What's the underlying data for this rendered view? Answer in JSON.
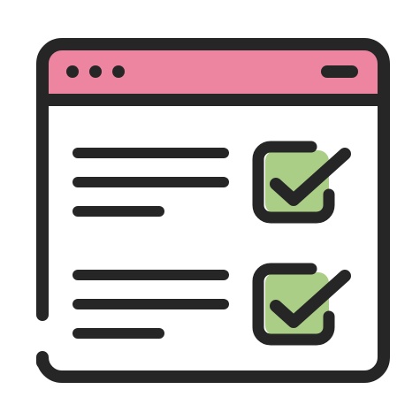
{
  "icon": {
    "name": "browser-checklist-icon",
    "colors": {
      "outline": "#262626",
      "title_bar": "#ED84A0",
      "window_body": "#FFFFFF",
      "checkbox_fill": "#ABCE87"
    },
    "window": {
      "title_bar_dots": 3,
      "title_bar_controls": [
        "minimize-icon"
      ]
    },
    "checklist": {
      "items": [
        {
          "checked": true,
          "text_lines": 3
        },
        {
          "checked": true,
          "text_lines": 3
        }
      ]
    }
  }
}
